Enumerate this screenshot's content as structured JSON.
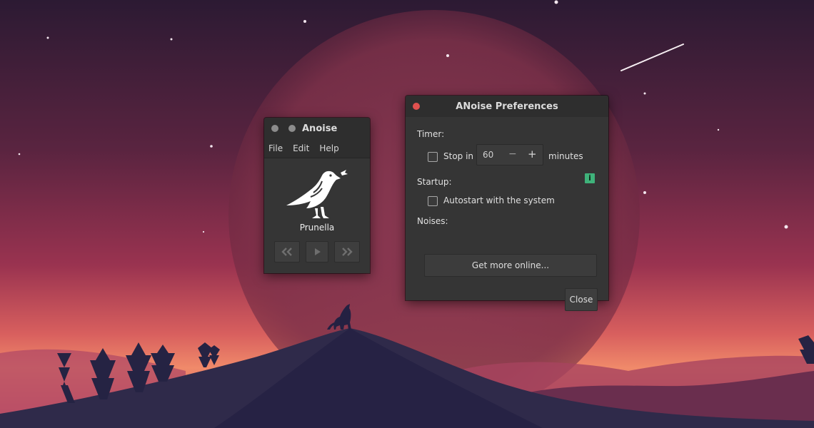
{
  "anoise_window": {
    "title": "Anoise",
    "menu": [
      "File",
      "Edit",
      "Help"
    ],
    "noise_name": "Prunella",
    "controls": {
      "previous_icon": "double-chevron-left-icon",
      "play_icon": "play-icon",
      "next_icon": "double-chevron-right-icon"
    }
  },
  "prefs_window": {
    "title": "ANoise Preferences",
    "timer_heading": "Timer:",
    "stop_in_label": "Stop in",
    "stop_in_value": "60",
    "minus_symbol": "−",
    "plus_symbol": "+",
    "minutes_label": "minutes",
    "info_symbol": "i",
    "startup_heading": "Startup:",
    "autostart_label": "Autostart with the system",
    "noises_heading": "Noises:",
    "get_more_label": "Get more online...",
    "close_label": "Close"
  },
  "colors": {
    "close_button": "#e0514f",
    "info_badge": "#3fb27a",
    "window_bg": "#353535",
    "titlebar_bg": "#2e2e2e"
  }
}
